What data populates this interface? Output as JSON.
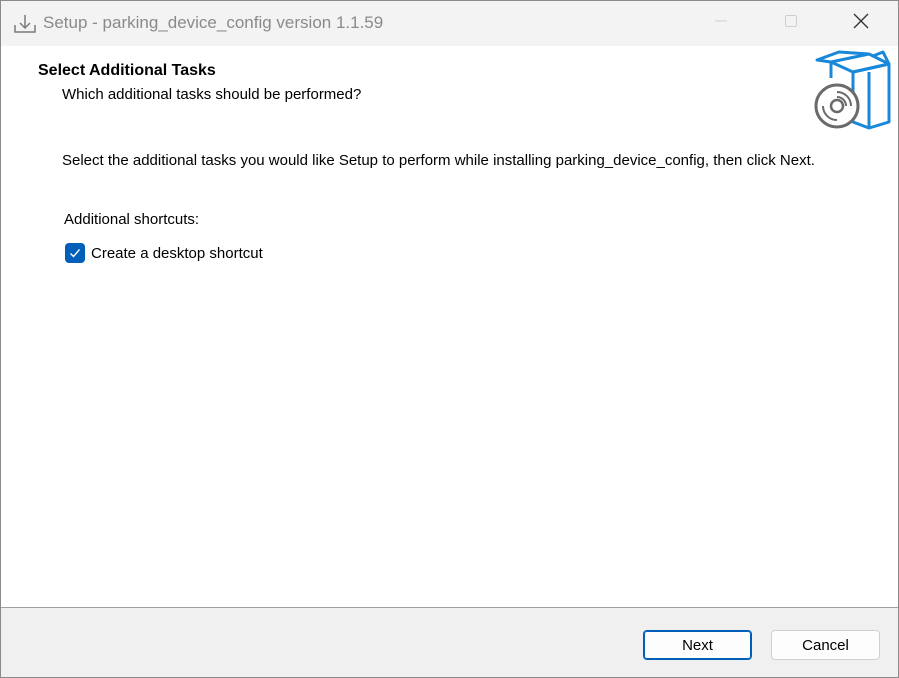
{
  "window": {
    "title": "Setup - parking_device_config version 1.1.59",
    "icons": {
      "app": "installer-download-icon",
      "minimize": "minimize-icon",
      "maximize": "maximize-icon",
      "close": "close-icon"
    }
  },
  "header": {
    "title": "Select Additional Tasks",
    "subtitle": "Which additional tasks should be performed?",
    "image_icon": "setup-box-disc-icon"
  },
  "body": {
    "instruction": "Select the additional tasks you would like Setup to perform while installing parking_device_config, then click Next.",
    "group_label": "Additional shortcuts:",
    "tasks": [
      {
        "label": "Create a desktop shortcut",
        "checked": true
      }
    ]
  },
  "footer": {
    "next_label": "Next",
    "cancel_label": "Cancel"
  },
  "colors": {
    "accent": "#005fb8",
    "titlebar": "#f3f3f3",
    "footer": "#f0f0f0",
    "title_text": "#8a8a8a",
    "image_blue": "#1a88d8"
  }
}
